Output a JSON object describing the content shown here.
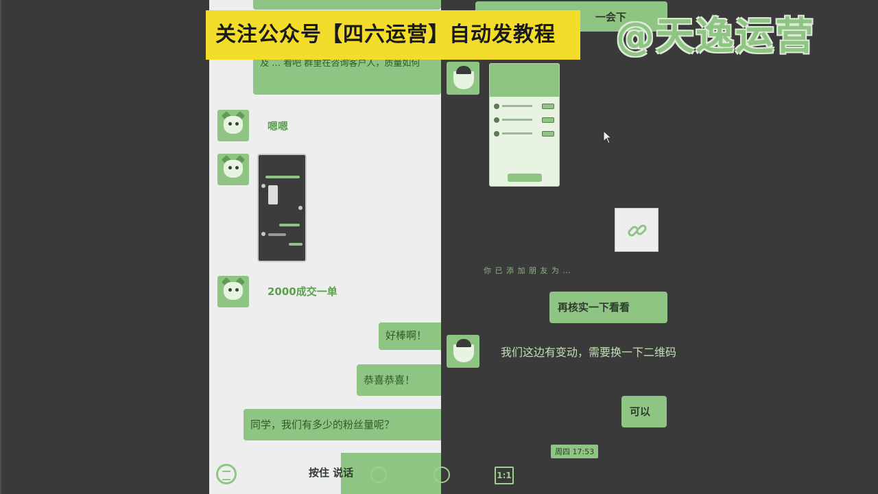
{
  "banner": {
    "text": "关注公众号【四六运营】自动发教程"
  },
  "watermark": {
    "text": "@天逸运营"
  },
  "left_chat": {
    "top_message": "及 … 看吧 群里在咨询客户人，质量如何",
    "reply_1": "嗯嗯",
    "reply_2": "2000成交一单",
    "sent_1": "好棒啊！",
    "sent_2": "恭喜恭喜！",
    "sent_3": "同学，我们有多少的粉丝量呢？",
    "press_to_talk_a": "按住",
    "press_to_talk_b": "说话"
  },
  "right_chat": {
    "top_bubble": "一会下",
    "system_notice": "你 已 添 加 朋 友 为 …",
    "sent_1": "再核实一下看看",
    "received_1": "我们这边有变动，需要换一下二维码",
    "sent_2": "可以",
    "timestamp": "周四 17:53"
  },
  "toolbar": {
    "ratio_label": "1:1",
    "icons": [
      "zoom-in-icon",
      "zoom-out-icon",
      "ratio-icon"
    ]
  },
  "colors": {
    "accent_green": "#8fc583",
    "dark_bg": "#3a3a3a",
    "banner_yellow": "#f3dd2a"
  }
}
